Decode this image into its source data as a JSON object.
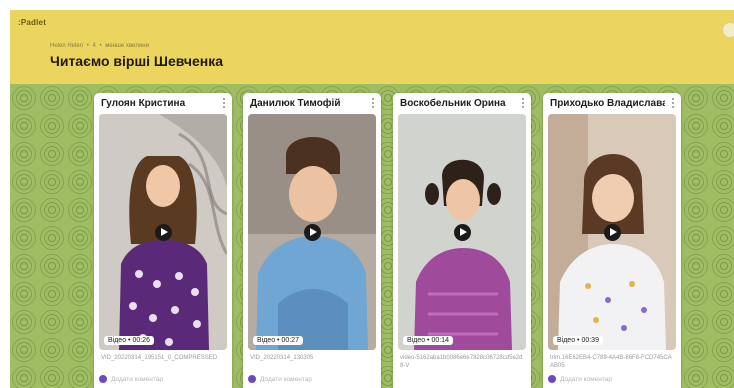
{
  "app": {
    "brand": ":Padlet"
  },
  "header": {
    "author": "Helen Helen",
    "likes": "4",
    "time": "менше хвилини",
    "title": "Читаємо вірші Шевченка",
    "color": "#ecd55e"
  },
  "posts": [
    {
      "title": "Гулоян Кристина",
      "type": "Відео",
      "duration": "00:26",
      "filename": "VID_20220314_195151_0_COMPRESSED",
      "comment_placeholder": "Додати коментар"
    },
    {
      "title": "Данилюк Тимофій",
      "type": "Відео",
      "duration": "00:27",
      "filename": "VID_20220314_130305",
      "comment_placeholder": "Додати коментар"
    },
    {
      "title": "Воскобельник Орина",
      "type": "Відео",
      "duration": "00:14",
      "filename": "video-5162aba1b0086e6e7828c06728cd5e2d8-V",
      "comment_placeholder": ""
    },
    {
      "title": "Приходько Владислава",
      "type": "Відео",
      "duration": "00:39",
      "filename": "trim.16E62EB4-C789-4A4B-86F8-FCD745CAAB05",
      "comment_placeholder": "Додати коментар"
    }
  ],
  "icons": {
    "play": "play-icon",
    "more": "more-vert-icon",
    "avatar": "commenter-avatar"
  },
  "colors": {
    "wallpaper": "#9fbd63",
    "avatar": "#6c48c5"
  }
}
